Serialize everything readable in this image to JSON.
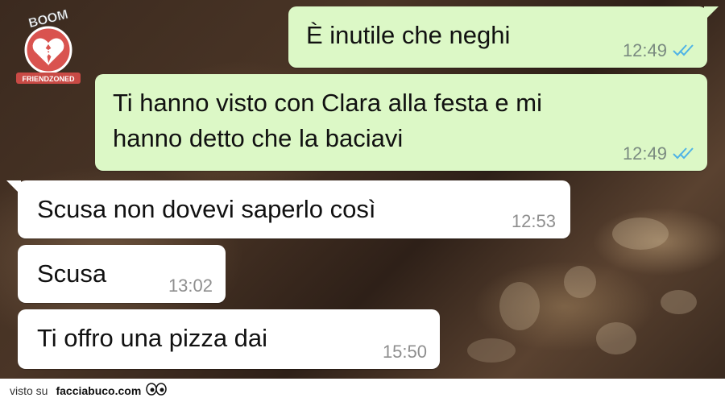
{
  "colors": {
    "outgoing_bubble": "#dcf8c6",
    "incoming_bubble": "#ffffff",
    "read_ticks": "#4fb3e6",
    "logo_red": "#d9534f"
  },
  "logo": {
    "top_text": "BOOM",
    "bottom_text": "FRIENDZONED",
    "icon": "broken-heart-icon"
  },
  "messages": [
    {
      "direction": "out",
      "text": "È inutile che neghi",
      "time": "12:49",
      "status": "read"
    },
    {
      "direction": "out",
      "text": "Ti hanno visto con Clara alla festa e mi\nhanno detto che la baciavi",
      "time": "12:49",
      "status": "read"
    },
    {
      "direction": "in",
      "text": "Scusa non dovevi saperlo così",
      "time": "12:53"
    },
    {
      "direction": "in",
      "text": "Scusa",
      "time": "13:02"
    },
    {
      "direction": "in",
      "text": "Ti offro una pizza dai",
      "time": "15:50"
    }
  ],
  "footer": {
    "prefix": "visto su",
    "site": "facciabuco.com",
    "icon": "eyes-icon"
  }
}
